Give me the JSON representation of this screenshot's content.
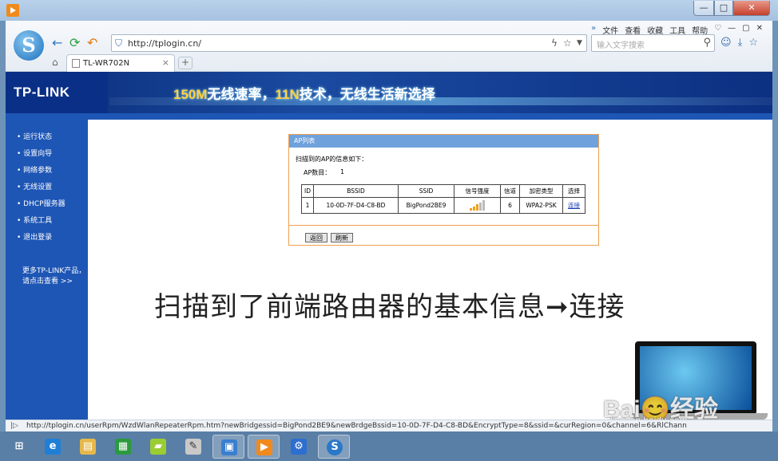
{
  "window": {
    "min": "—",
    "max": "□",
    "close": "✕"
  },
  "menu": [
    "文件",
    "查看",
    "收藏",
    "工具",
    "帮助"
  ],
  "address": {
    "url": "http://tplogin.cn/"
  },
  "search": {
    "placeholder": "输入文字搜索"
  },
  "tab": {
    "title": "TL-WR702N",
    "close": "×",
    "new": "+"
  },
  "banner": {
    "brand": "TP-LINK",
    "slogan_a": "150M",
    "slogan_b": "无线速率，",
    "slogan_c": "11N",
    "slogan_d": "技术，无线生活新选择"
  },
  "sidebar": {
    "items": [
      "运行状态",
      "设置向导",
      "网络参数",
      "无线设置",
      "DHCP服务器",
      "系统工具",
      "退出登录"
    ],
    "more_line1": "更多TP-LINK产品，",
    "more_line2": "请点击查看 >>"
  },
  "ap_panel": {
    "title": "AP列表",
    "intro": "扫描到的AP的信息如下：",
    "count_label": "AP数目：",
    "count_value": "1",
    "headers": [
      "ID",
      "BSSID",
      "SSID",
      "信号强度",
      "信道",
      "加密类型",
      "选择"
    ],
    "row": {
      "id": "1",
      "bssid": "10-0D-7F-D4-C8-BD",
      "ssid": "BigPond2BE9",
      "signal_bars_filled": 3,
      "signal_bars_total": 5,
      "channel": "6",
      "encryption": "WPA2-PSK",
      "action": "连接"
    },
    "back_button": "返回",
    "refresh_button": "刷新"
  },
  "caption": "扫描到了前端路由器的基本信息➞连接",
  "watermark": {
    "main": "Bai😊经验",
    "sub": "jingyan.baidu.com"
  },
  "status_url": "http://tplogin.cn/userRpm/WzdWlanRepeaterRpm.htm?newBridgessid=BigPond2BE9&newBrdgeBssid=10-0D-7F-D4-C8-BD&EncryptType=8&ssid=&curRegion=0&channel=6&RlChann"
}
